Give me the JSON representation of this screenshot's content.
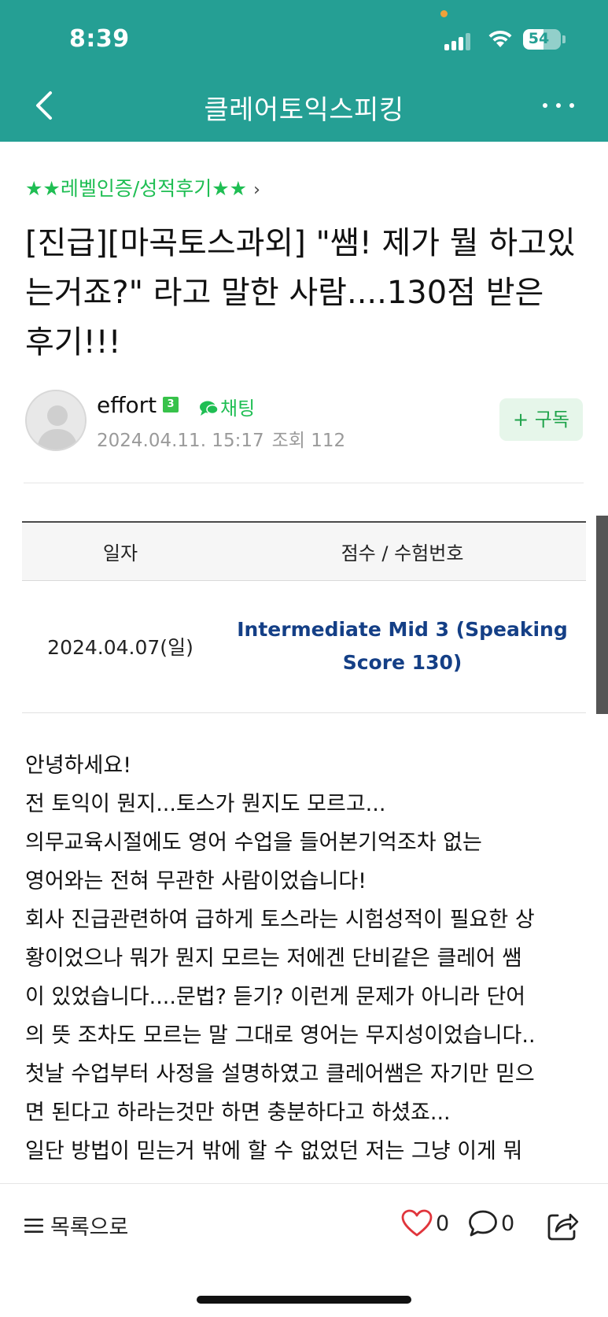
{
  "status_bar": {
    "time": "8:39",
    "battery": "54",
    "battery_level": 0.54
  },
  "nav": {
    "title": "클레어토익스피킹"
  },
  "board": {
    "label": "★★레벨인증/성적후기★★"
  },
  "post": {
    "title": "[진급][마곡토스과외] \"쌤! 제가 뭘 하고있는거죠?\" 라고 말한 사람....130점 받은 후기!!!",
    "author": "effort",
    "author_level": "3",
    "chat_label": "채팅",
    "datetime": "2024.04.11. 15:17",
    "views": "조회 112",
    "subscribe_label": "+ 구독"
  },
  "score_table": {
    "headers": [
      "일자",
      "점수 / 수험번호"
    ],
    "rows": [
      {
        "date": "2024.04.07(일)",
        "score": "Intermediate Mid 3 (Speaking Score 130)"
      }
    ]
  },
  "body_lines": [
    "안녕하세요!",
    "전 토익이 뭔지...토스가 뭔지도 모르고...",
    "의무교육시절에도 영어 수업을 들어본기억조차 없는",
    "영어와는 전혀 무관한 사람이었습니다!",
    "회사 진급관련하여 급하게 토스라는 시험성적이 필요한 상",
    "황이었으나 뭐가 뭔지 모르는 저에겐 단비같은 클레어 쌤",
    "이 있었습니다....문법? 듣기? 이런게 문제가 아니라 단어",
    "의 뜻 조차도 모르는 말 그대로 영어는 무지성이었습니다..",
    "첫날 수업부터 사정을 설명하였고 클레어쌤은 자기만 믿으",
    "면 된다고 하라는것만 하면 충분하다고 하셨죠...",
    "일단 방법이 믿는거 밖에 할 수 없었던 저는 그냥 이게 뭐"
  ],
  "bottom_bar": {
    "list_label": "목록으로",
    "like_count": "0",
    "comment_count": "0"
  },
  "colors": {
    "header_bg": "#259f94",
    "accent_green": "#1fbe53",
    "score_blue": "#143f86"
  }
}
